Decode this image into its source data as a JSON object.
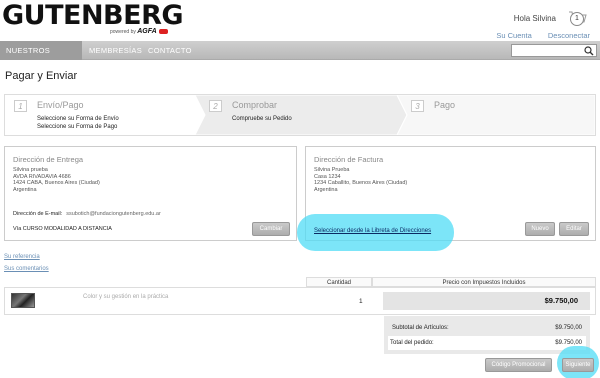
{
  "header": {
    "logo_text": "GUTENBERG",
    "powered_by": "powered by",
    "powered_brand": "AGFA",
    "greeting": "Hola Silvina",
    "cart_count": "1",
    "account_link": "Su Cuenta",
    "logout_link": "Desconectar"
  },
  "nav": {
    "items": [
      {
        "label": "Nuestros Cursos"
      },
      {
        "label": "Membresías"
      },
      {
        "label": "Contacto"
      }
    ],
    "search": {
      "value": "",
      "placeholder": ""
    }
  },
  "page": {
    "title": "Pagar y Enviar"
  },
  "steps": [
    {
      "num": "1",
      "title": "Envío/Pago",
      "desc1": "Seleccione su Forma de Envío",
      "desc2": "Seleccione su Forma de Pago"
    },
    {
      "num": "2",
      "title": "Comprobar",
      "desc1": "Compruebe su Pedido"
    },
    {
      "num": "3",
      "title": "Pago"
    }
  ],
  "delivery": {
    "title": "Dirección de Entrega",
    "lines": [
      "Silvina prueba",
      "AVDA RIVADAVIA 4686",
      "1424 CABA, Buenos Aires (Ciudad)",
      "Argentina"
    ],
    "email_label": "Dirección de E-mail:",
    "email": "ssubotich@fundaciongutenberg.edu.ar",
    "via": "Vía CURSO MODALIDAD A DISTANCIA",
    "change_button": "Cambiar"
  },
  "billing": {
    "title": "Dirección de Factura",
    "lines": [
      "Silvina Prueba",
      "Casa 1234",
      "1234 Caballito, Buenos Aires (Ciudad)",
      "Argentina"
    ],
    "address_book_link": "Seleccionar desde la Libreta de Direcciones",
    "new_button": "Nuevo",
    "edit_button": "Editar"
  },
  "links": {
    "reference": "Su referencia",
    "comments": "Sus comentarios"
  },
  "table": {
    "headers": {
      "quantity": "Cantidad",
      "price": "Precio con Impuestos Incluidos"
    },
    "rows": [
      {
        "name": "Color y su gestión en la práctica",
        "qty": "1",
        "price": "$9.750,00"
      }
    ]
  },
  "totals": {
    "subtotal_label": "Subtotal de Artículos:",
    "subtotal": "$9.750,00",
    "total_label": "Total del pedido:",
    "total": "$9.750,00"
  },
  "buttons": {
    "promo": "Código Promocional",
    "next": "Siguiente"
  },
  "colors": {
    "highlight": "#50dcf5",
    "link": "#6a8fb5",
    "nav_bg": "#c4c4c4",
    "agfa_red": "#dd2222"
  }
}
